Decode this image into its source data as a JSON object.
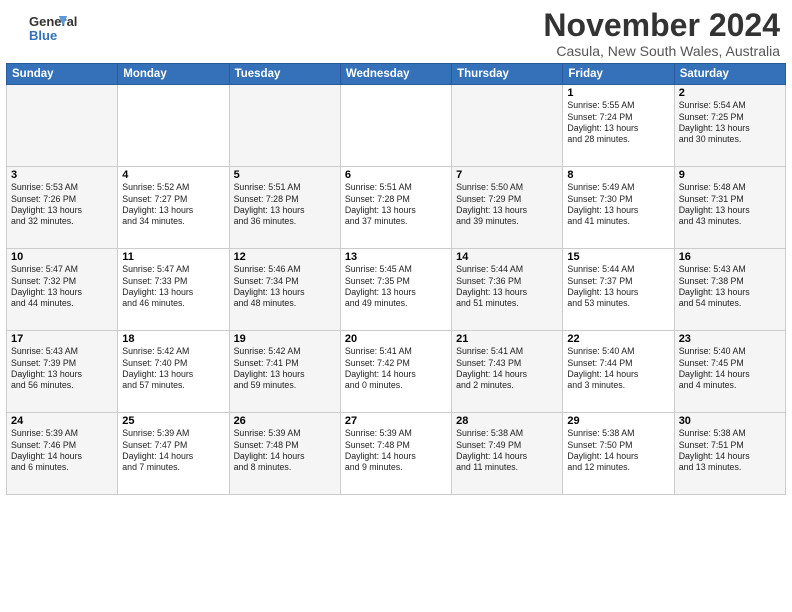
{
  "header": {
    "logo_line1": "General",
    "logo_line2": "Blue",
    "month_title": "November 2024",
    "subtitle": "Casula, New South Wales, Australia"
  },
  "weekdays": [
    "Sunday",
    "Monday",
    "Tuesday",
    "Wednesday",
    "Thursday",
    "Friday",
    "Saturday"
  ],
  "weeks": [
    [
      {
        "day": "",
        "info": ""
      },
      {
        "day": "",
        "info": ""
      },
      {
        "day": "",
        "info": ""
      },
      {
        "day": "",
        "info": ""
      },
      {
        "day": "",
        "info": ""
      },
      {
        "day": "1",
        "info": "Sunrise: 5:55 AM\nSunset: 7:24 PM\nDaylight: 13 hours\nand 28 minutes."
      },
      {
        "day": "2",
        "info": "Sunrise: 5:54 AM\nSunset: 7:25 PM\nDaylight: 13 hours\nand 30 minutes."
      }
    ],
    [
      {
        "day": "3",
        "info": "Sunrise: 5:53 AM\nSunset: 7:26 PM\nDaylight: 13 hours\nand 32 minutes."
      },
      {
        "day": "4",
        "info": "Sunrise: 5:52 AM\nSunset: 7:27 PM\nDaylight: 13 hours\nand 34 minutes."
      },
      {
        "day": "5",
        "info": "Sunrise: 5:51 AM\nSunset: 7:28 PM\nDaylight: 13 hours\nand 36 minutes."
      },
      {
        "day": "6",
        "info": "Sunrise: 5:51 AM\nSunset: 7:28 PM\nDaylight: 13 hours\nand 37 minutes."
      },
      {
        "day": "7",
        "info": "Sunrise: 5:50 AM\nSunset: 7:29 PM\nDaylight: 13 hours\nand 39 minutes."
      },
      {
        "day": "8",
        "info": "Sunrise: 5:49 AM\nSunset: 7:30 PM\nDaylight: 13 hours\nand 41 minutes."
      },
      {
        "day": "9",
        "info": "Sunrise: 5:48 AM\nSunset: 7:31 PM\nDaylight: 13 hours\nand 43 minutes."
      }
    ],
    [
      {
        "day": "10",
        "info": "Sunrise: 5:47 AM\nSunset: 7:32 PM\nDaylight: 13 hours\nand 44 minutes."
      },
      {
        "day": "11",
        "info": "Sunrise: 5:47 AM\nSunset: 7:33 PM\nDaylight: 13 hours\nand 46 minutes."
      },
      {
        "day": "12",
        "info": "Sunrise: 5:46 AM\nSunset: 7:34 PM\nDaylight: 13 hours\nand 48 minutes."
      },
      {
        "day": "13",
        "info": "Sunrise: 5:45 AM\nSunset: 7:35 PM\nDaylight: 13 hours\nand 49 minutes."
      },
      {
        "day": "14",
        "info": "Sunrise: 5:44 AM\nSunset: 7:36 PM\nDaylight: 13 hours\nand 51 minutes."
      },
      {
        "day": "15",
        "info": "Sunrise: 5:44 AM\nSunset: 7:37 PM\nDaylight: 13 hours\nand 53 minutes."
      },
      {
        "day": "16",
        "info": "Sunrise: 5:43 AM\nSunset: 7:38 PM\nDaylight: 13 hours\nand 54 minutes."
      }
    ],
    [
      {
        "day": "17",
        "info": "Sunrise: 5:43 AM\nSunset: 7:39 PM\nDaylight: 13 hours\nand 56 minutes."
      },
      {
        "day": "18",
        "info": "Sunrise: 5:42 AM\nSunset: 7:40 PM\nDaylight: 13 hours\nand 57 minutes."
      },
      {
        "day": "19",
        "info": "Sunrise: 5:42 AM\nSunset: 7:41 PM\nDaylight: 13 hours\nand 59 minutes."
      },
      {
        "day": "20",
        "info": "Sunrise: 5:41 AM\nSunset: 7:42 PM\nDaylight: 14 hours\nand 0 minutes."
      },
      {
        "day": "21",
        "info": "Sunrise: 5:41 AM\nSunset: 7:43 PM\nDaylight: 14 hours\nand 2 minutes."
      },
      {
        "day": "22",
        "info": "Sunrise: 5:40 AM\nSunset: 7:44 PM\nDaylight: 14 hours\nand 3 minutes."
      },
      {
        "day": "23",
        "info": "Sunrise: 5:40 AM\nSunset: 7:45 PM\nDaylight: 14 hours\nand 4 minutes."
      }
    ],
    [
      {
        "day": "24",
        "info": "Sunrise: 5:39 AM\nSunset: 7:46 PM\nDaylight: 14 hours\nand 6 minutes."
      },
      {
        "day": "25",
        "info": "Sunrise: 5:39 AM\nSunset: 7:47 PM\nDaylight: 14 hours\nand 7 minutes."
      },
      {
        "day": "26",
        "info": "Sunrise: 5:39 AM\nSunset: 7:48 PM\nDaylight: 14 hours\nand 8 minutes."
      },
      {
        "day": "27",
        "info": "Sunrise: 5:39 AM\nSunset: 7:48 PM\nDaylight: 14 hours\nand 9 minutes."
      },
      {
        "day": "28",
        "info": "Sunrise: 5:38 AM\nSunset: 7:49 PM\nDaylight: 14 hours\nand 11 minutes."
      },
      {
        "day": "29",
        "info": "Sunrise: 5:38 AM\nSunset: 7:50 PM\nDaylight: 14 hours\nand 12 minutes."
      },
      {
        "day": "30",
        "info": "Sunrise: 5:38 AM\nSunset: 7:51 PM\nDaylight: 14 hours\nand 13 minutes."
      }
    ]
  ]
}
